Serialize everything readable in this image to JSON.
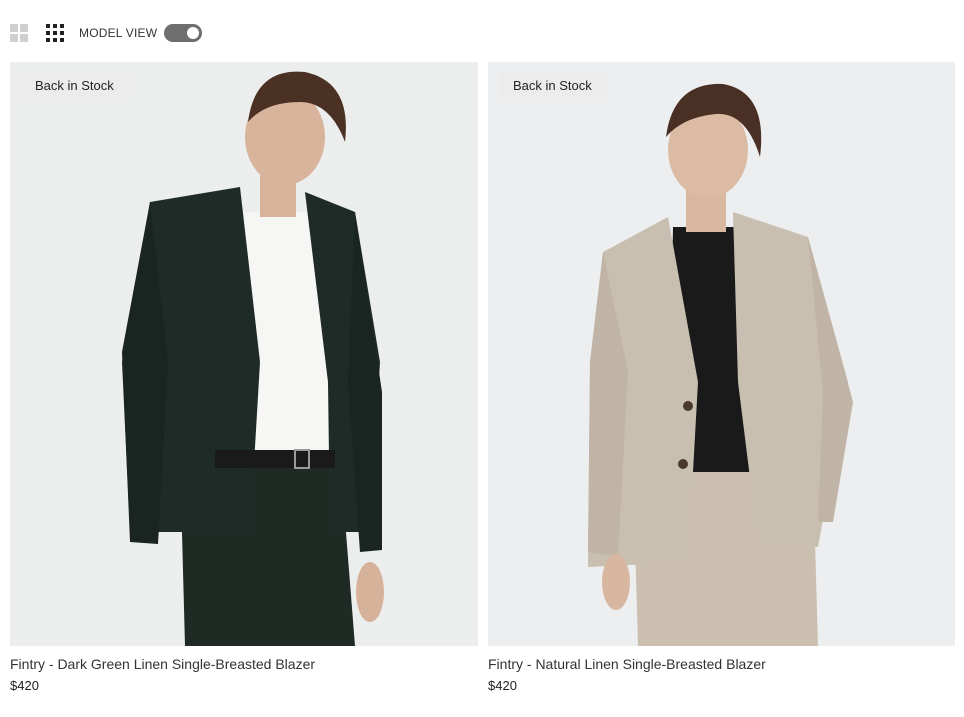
{
  "toolbar": {
    "grid_two_icon": "grid-2x2-icon",
    "grid_three_icon": "grid-3x3-icon",
    "model_view_label": "MODEL VIEW",
    "model_view_on": true
  },
  "products": [
    {
      "badge": "Back in Stock",
      "title": "Fintry - Dark Green Linen Single-Breasted Blazer",
      "price": "$420",
      "jacket_color": "#1f2b26",
      "shirt_color": "#f7f7f5"
    },
    {
      "badge": "Back in Stock",
      "title": "Fintry - Natural Linen Single-Breasted Blazer",
      "price": "$420",
      "jacket_color": "#c9bfb1",
      "shirt_color": "#1a1a1a"
    }
  ],
  "colors": {
    "toggle_on": "#6e6e6e",
    "photo_bg": "#ecedef",
    "badge_bg": "#ececec"
  }
}
